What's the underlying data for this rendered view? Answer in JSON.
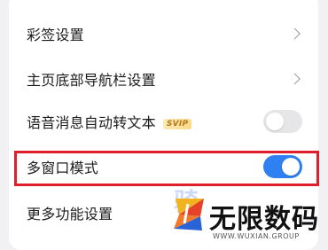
{
  "settings": {
    "rows": [
      {
        "label": "彩签设置",
        "control": "chevron"
      },
      {
        "label": "主页底部导航栏设置",
        "control": "chevron"
      },
      {
        "label": "语音消息自动转文本",
        "badge": "SVIP",
        "control": "toggle",
        "enabled": false
      },
      {
        "label": "多窗口模式",
        "control": "toggle",
        "enabled": true
      },
      {
        "label": "更多功能设置",
        "control": "none"
      }
    ]
  },
  "highlight_color": "#e01f2c",
  "toggle_on_color": "#2f80f0",
  "watermark": {
    "ghost_text": "骑",
    "brand": "无限数码",
    "url": "WWW.WUXIAN.GROUP"
  }
}
